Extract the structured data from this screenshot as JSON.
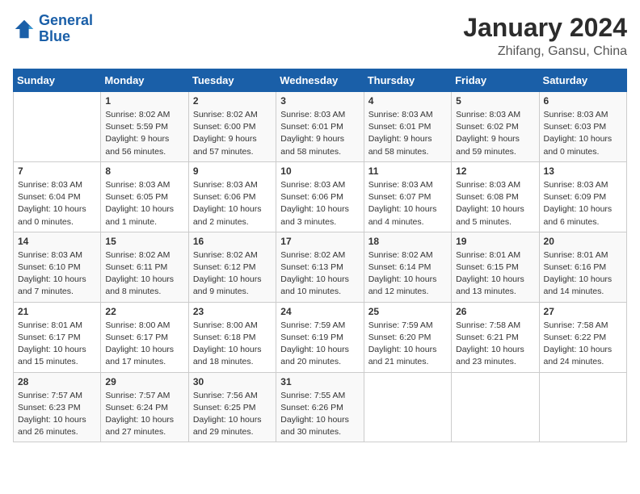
{
  "header": {
    "logo_line1": "General",
    "logo_line2": "Blue",
    "title": "January 2024",
    "subtitle": "Zhifang, Gansu, China"
  },
  "days_of_week": [
    "Sunday",
    "Monday",
    "Tuesday",
    "Wednesday",
    "Thursday",
    "Friday",
    "Saturday"
  ],
  "weeks": [
    [
      {
        "day": "",
        "info": ""
      },
      {
        "day": "1",
        "info": "Sunrise: 8:02 AM\nSunset: 5:59 PM\nDaylight: 9 hours\nand 56 minutes."
      },
      {
        "day": "2",
        "info": "Sunrise: 8:02 AM\nSunset: 6:00 PM\nDaylight: 9 hours\nand 57 minutes."
      },
      {
        "day": "3",
        "info": "Sunrise: 8:03 AM\nSunset: 6:01 PM\nDaylight: 9 hours\nand 58 minutes."
      },
      {
        "day": "4",
        "info": "Sunrise: 8:03 AM\nSunset: 6:01 PM\nDaylight: 9 hours\nand 58 minutes."
      },
      {
        "day": "5",
        "info": "Sunrise: 8:03 AM\nSunset: 6:02 PM\nDaylight: 9 hours\nand 59 minutes."
      },
      {
        "day": "6",
        "info": "Sunrise: 8:03 AM\nSunset: 6:03 PM\nDaylight: 10 hours\nand 0 minutes."
      }
    ],
    [
      {
        "day": "7",
        "info": "Sunrise: 8:03 AM\nSunset: 6:04 PM\nDaylight: 10 hours\nand 0 minutes."
      },
      {
        "day": "8",
        "info": "Sunrise: 8:03 AM\nSunset: 6:05 PM\nDaylight: 10 hours\nand 1 minute."
      },
      {
        "day": "9",
        "info": "Sunrise: 8:03 AM\nSunset: 6:06 PM\nDaylight: 10 hours\nand 2 minutes."
      },
      {
        "day": "10",
        "info": "Sunrise: 8:03 AM\nSunset: 6:06 PM\nDaylight: 10 hours\nand 3 minutes."
      },
      {
        "day": "11",
        "info": "Sunrise: 8:03 AM\nSunset: 6:07 PM\nDaylight: 10 hours\nand 4 minutes."
      },
      {
        "day": "12",
        "info": "Sunrise: 8:03 AM\nSunset: 6:08 PM\nDaylight: 10 hours\nand 5 minutes."
      },
      {
        "day": "13",
        "info": "Sunrise: 8:03 AM\nSunset: 6:09 PM\nDaylight: 10 hours\nand 6 minutes."
      }
    ],
    [
      {
        "day": "14",
        "info": "Sunrise: 8:03 AM\nSunset: 6:10 PM\nDaylight: 10 hours\nand 7 minutes."
      },
      {
        "day": "15",
        "info": "Sunrise: 8:02 AM\nSunset: 6:11 PM\nDaylight: 10 hours\nand 8 minutes."
      },
      {
        "day": "16",
        "info": "Sunrise: 8:02 AM\nSunset: 6:12 PM\nDaylight: 10 hours\nand 9 minutes."
      },
      {
        "day": "17",
        "info": "Sunrise: 8:02 AM\nSunset: 6:13 PM\nDaylight: 10 hours\nand 10 minutes."
      },
      {
        "day": "18",
        "info": "Sunrise: 8:02 AM\nSunset: 6:14 PM\nDaylight: 10 hours\nand 12 minutes."
      },
      {
        "day": "19",
        "info": "Sunrise: 8:01 AM\nSunset: 6:15 PM\nDaylight: 10 hours\nand 13 minutes."
      },
      {
        "day": "20",
        "info": "Sunrise: 8:01 AM\nSunset: 6:16 PM\nDaylight: 10 hours\nand 14 minutes."
      }
    ],
    [
      {
        "day": "21",
        "info": "Sunrise: 8:01 AM\nSunset: 6:17 PM\nDaylight: 10 hours\nand 15 minutes."
      },
      {
        "day": "22",
        "info": "Sunrise: 8:00 AM\nSunset: 6:17 PM\nDaylight: 10 hours\nand 17 minutes."
      },
      {
        "day": "23",
        "info": "Sunrise: 8:00 AM\nSunset: 6:18 PM\nDaylight: 10 hours\nand 18 minutes."
      },
      {
        "day": "24",
        "info": "Sunrise: 7:59 AM\nSunset: 6:19 PM\nDaylight: 10 hours\nand 20 minutes."
      },
      {
        "day": "25",
        "info": "Sunrise: 7:59 AM\nSunset: 6:20 PM\nDaylight: 10 hours\nand 21 minutes."
      },
      {
        "day": "26",
        "info": "Sunrise: 7:58 AM\nSunset: 6:21 PM\nDaylight: 10 hours\nand 23 minutes."
      },
      {
        "day": "27",
        "info": "Sunrise: 7:58 AM\nSunset: 6:22 PM\nDaylight: 10 hours\nand 24 minutes."
      }
    ],
    [
      {
        "day": "28",
        "info": "Sunrise: 7:57 AM\nSunset: 6:23 PM\nDaylight: 10 hours\nand 26 minutes."
      },
      {
        "day": "29",
        "info": "Sunrise: 7:57 AM\nSunset: 6:24 PM\nDaylight: 10 hours\nand 27 minutes."
      },
      {
        "day": "30",
        "info": "Sunrise: 7:56 AM\nSunset: 6:25 PM\nDaylight: 10 hours\nand 29 minutes."
      },
      {
        "day": "31",
        "info": "Sunrise: 7:55 AM\nSunset: 6:26 PM\nDaylight: 10 hours\nand 30 minutes."
      },
      {
        "day": "",
        "info": ""
      },
      {
        "day": "",
        "info": ""
      },
      {
        "day": "",
        "info": ""
      }
    ]
  ]
}
